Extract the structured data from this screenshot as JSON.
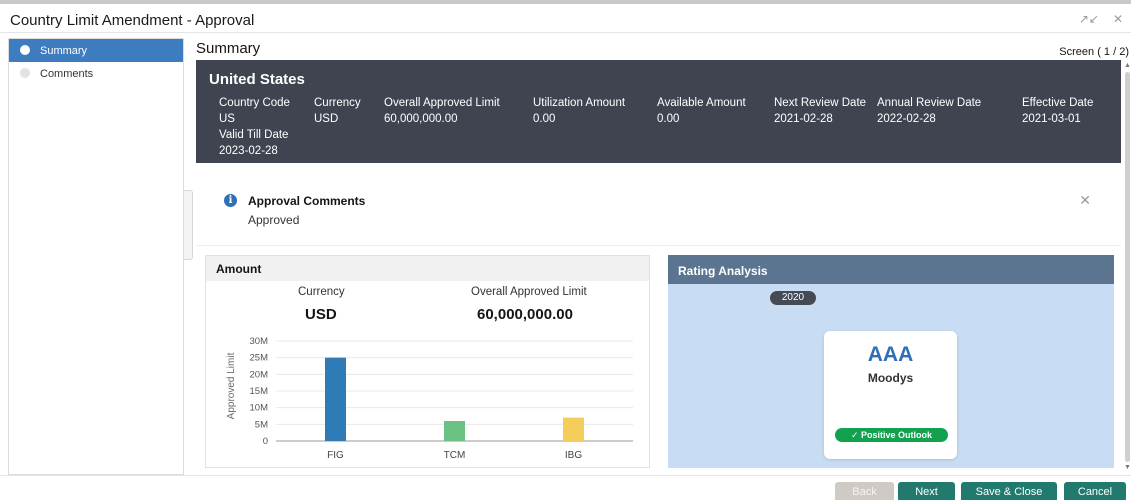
{
  "window": {
    "title": "Country Limit Amendment - Approval",
    "minimize_glyph": "↗↙",
    "close_glyph": "✕"
  },
  "sidebar": {
    "items": [
      {
        "label": "Summary"
      },
      {
        "label": "Comments"
      }
    ]
  },
  "main": {
    "title": "Summary",
    "screen_indicator": "Screen ( 1 / 2)"
  },
  "summary": {
    "country": "United States",
    "fields": [
      {
        "label": "Country Code",
        "value": "US"
      },
      {
        "label": "Currency",
        "value": "USD"
      },
      {
        "label": "Overall Approved Limit",
        "value": "60,000,000.00"
      },
      {
        "label": "Utilization Amount",
        "value": "0.00"
      },
      {
        "label": "Available Amount",
        "value": "0.00"
      },
      {
        "label": "Next Review Date",
        "value": "2021-02-28"
      },
      {
        "label": "Annual Review Date",
        "value": "2022-02-28"
      },
      {
        "label": "Effective Date",
        "value": "2021-03-01"
      },
      {
        "label": "Valid Till Date",
        "value": "2023-02-28"
      }
    ]
  },
  "comments": {
    "heading": "Approval Comments",
    "text": "Approved",
    "info_glyph": "i",
    "close_glyph": "✕"
  },
  "amount": {
    "title": "Amount",
    "currency_label": "Currency",
    "currency_value": "USD",
    "limit_label": "Overall Approved Limit",
    "limit_value": "60,000,000.00"
  },
  "chart_data": {
    "type": "bar",
    "categories": [
      "FIG",
      "TCM",
      "IBG"
    ],
    "values": [
      25000000,
      6000000,
      7000000
    ],
    "colors": [
      "#2e7bb6",
      "#6cc282",
      "#f5cd5a"
    ],
    "ylabel": "Approved Limit",
    "xlabel": "",
    "ylim": [
      0,
      30000000
    ],
    "yticks": [
      {
        "value": 0,
        "label": "0"
      },
      {
        "value": 5000000,
        "label": "5M"
      },
      {
        "value": 10000000,
        "label": "10M"
      },
      {
        "value": 15000000,
        "label": "15M"
      },
      {
        "value": 20000000,
        "label": "20M"
      },
      {
        "value": 25000000,
        "label": "25M"
      },
      {
        "value": 30000000,
        "label": "30M"
      }
    ],
    "grid": true
  },
  "rating": {
    "title": "Rating Analysis",
    "year": "2020",
    "grade": "AAA",
    "agency": "Moodys",
    "outlook": "✓ Positive Outlook"
  },
  "footer": {
    "back_label": "Back",
    "next_label": "Next",
    "save_close_label": "Save & Close",
    "cancel_label": "Cancel"
  },
  "colors": {
    "accent": "#3d7cbf",
    "summary_bg": "#3f4450",
    "rating_bg": "#c8ddf4",
    "button": "#227a6e",
    "positive": "#11a14f"
  }
}
